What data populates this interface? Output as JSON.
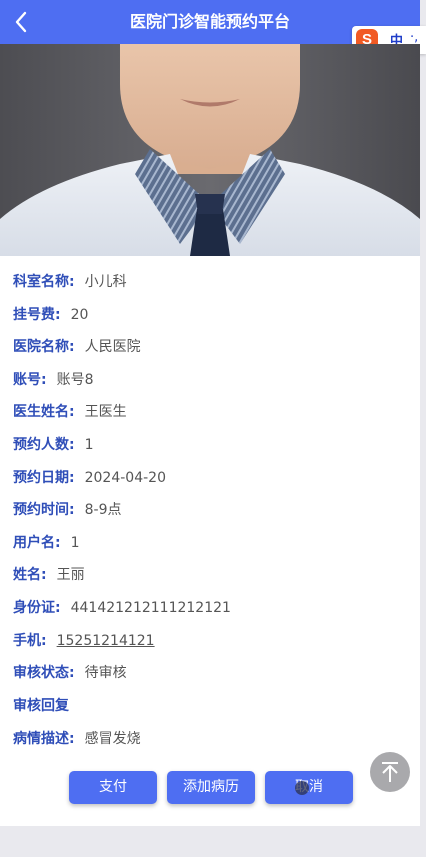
{
  "header": {
    "title": "医院门诊智能预约平台"
  },
  "ime": {
    "logo": "S",
    "lang": "中",
    "dots": "·,"
  },
  "details": {
    "department": {
      "label": "科室名称:",
      "value": "小儿科"
    },
    "fee": {
      "label": "挂号费:",
      "value": "20"
    },
    "hospital": {
      "label": "医院名称:",
      "value": "人民医院"
    },
    "account": {
      "label": "账号:",
      "value": "账号8"
    },
    "doctor": {
      "label": "医生姓名:",
      "value": "王医生"
    },
    "people": {
      "label": "预约人数:",
      "value": "1"
    },
    "date": {
      "label": "预约日期:",
      "value": "2024-04-20"
    },
    "time": {
      "label": "预约时间:",
      "value": "8-9点"
    },
    "username": {
      "label": "用户名:",
      "value": "1"
    },
    "name": {
      "label": "姓名:",
      "value": "王丽"
    },
    "idcard": {
      "label": "身份证:",
      "value": "441421212111212121"
    },
    "phone": {
      "label": "手机:",
      "value": "15251214121"
    },
    "audit_status": {
      "label": "审核状态:",
      "value": "待审核"
    },
    "audit_reply": {
      "label": "审核回复",
      "value": ""
    },
    "illness": {
      "label": "病情描述:",
      "value": "感冒发烧"
    }
  },
  "actions": {
    "pay": "支付",
    "add_record": "添加病历",
    "cancel": "取消"
  },
  "colors": {
    "primary": "#4e6ef2",
    "label": "#2f4eb8",
    "value": "#555555"
  },
  "icons": {
    "back": "chevron-left-icon",
    "scroll_top": "arrow-up-icon"
  }
}
